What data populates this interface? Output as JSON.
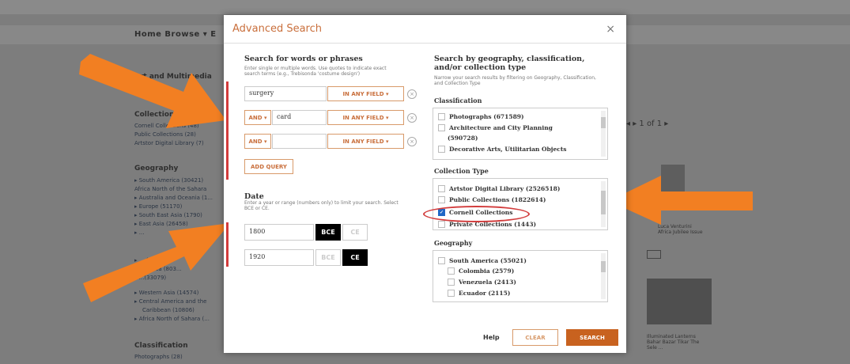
{
  "background": {
    "nav_text": "Home    Browse ▾    E",
    "left_heading": "Art and Multimedia",
    "section_collection": "Collection",
    "collection_links": [
      "Cornell Collections (48)",
      "Public Collections (28)",
      "Artstor Digital Library (7)"
    ],
    "section_geography": "Geography",
    "geography_links": [
      "▸ South America (30421)",
      "Africa North of the Sahara",
      "▸ Australia and Oceania (1...",
      "▸ Europe (51170)",
      "▸ South East Asia (1790)",
      "▸ East Asia (26458)",
      "▸ ...",
      "▸ ... (28295)",
      "▸ ... Africa (803...",
      "▸ ...(33079)",
      "▸ Western Asia (14574)",
      "▸ Central America and the",
      "Caribbean (10806)",
      "▸ Africa North of Sahara (..."
    ],
    "section_classification": "Classification",
    "classification_link": "Photographs (28)",
    "pager": "◂  ▸   1  of 1  ▸",
    "caption_1": "Luca Venturini Africa Jubilee Issue",
    "caption_2": "Illuminated Lanterns Bahar Bazar Tikar The Sele ..."
  },
  "modal": {
    "title": "Advanced Search",
    "close": "×",
    "left": {
      "heading": "Search for words or phrases",
      "hint": "Enter single or multiple words. Use quotes to indicate exact search terms (e.g., Trebisonda 'costume design')",
      "rows": [
        {
          "operator": "",
          "term": "surgery",
          "field": "IN ANY FIELD ▾"
        },
        {
          "operator": "AND ▾",
          "term": "card",
          "field": "IN ANY FIELD ▾"
        },
        {
          "operator": "AND ▾",
          "term": "",
          "field": "IN ANY FIELD ▾"
        }
      ],
      "remove_icon": "×",
      "add_query": "ADD QUERY",
      "date_heading": "Date",
      "date_hint": "Enter a year or range (numbers only) to limit your search. Select BCE or CE.",
      "date_from": "1800",
      "date_to": "1920",
      "bce": "BCE",
      "ce": "CE"
    },
    "right": {
      "heading": "Search by geography, classification, and/or collection type",
      "hint": "Narrow your search results by filtering on Geography, Classification, and Collection Type",
      "classification_label": "Classification",
      "classification_items": [
        "Photographs (671589)",
        "Architecture and City Planning",
        "(590728)",
        "Decorative Arts, Utilitarian Objects"
      ],
      "collection_type_label": "Collection Type",
      "collection_items": [
        {
          "label": "Artstor Digital Library (2526518)",
          "checked": false
        },
        {
          "label": "Public Collections (1822614)",
          "checked": false
        },
        {
          "label": "Cornell Collections",
          "checked": true
        },
        {
          "label": "Private Collections (1443)",
          "checked": false
        }
      ],
      "geography_label": "Geography",
      "geography_items": [
        "South America (55021)",
        "Colombia (2579)",
        "Venezuela (2413)",
        "Ecuador (2115)"
      ]
    },
    "footer": {
      "help": "Help",
      "clear": "CLEAR",
      "search": "SEARCH"
    }
  },
  "colors": {
    "accent": "#c96f3c",
    "search_button": "#c8621f",
    "annotation_red": "#d23c3c",
    "arrow_orange": "#f27f22",
    "checkbox_blue": "#1f67c6"
  }
}
